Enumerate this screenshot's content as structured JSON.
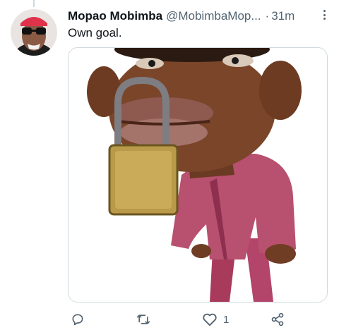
{
  "tweet": {
    "author_name": "Mopao Mobimba",
    "author_handle": "@MobimbaMop...",
    "separator": "·",
    "time": "31m",
    "text": "Own goal.",
    "media_alt": "Caricature of a man with a padlock through his lips"
  },
  "actions": {
    "reply_count": "",
    "retweet_count": "",
    "like_count": "1",
    "share_label": ""
  },
  "icons": {
    "reply": "reply-icon",
    "retweet": "retweet-icon",
    "like": "heart-icon",
    "share": "share-icon",
    "more": "more-icon"
  },
  "colors": {
    "text": "#0f1419",
    "secondary": "#536471",
    "border": "#cfd9de",
    "shirt": "#b8506f",
    "padlock": "#b99a4a"
  }
}
